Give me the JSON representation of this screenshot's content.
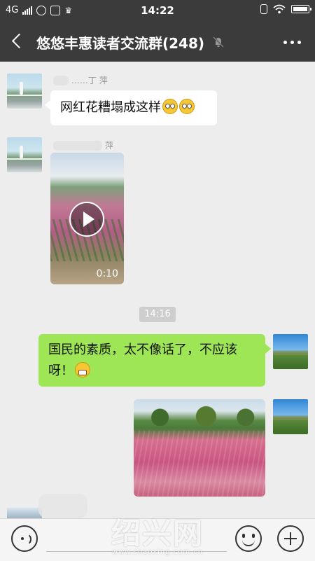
{
  "status_bar": {
    "network": "4G",
    "time": "14:22"
  },
  "header": {
    "title": "悠悠丰惠读者交流群(248)",
    "icons": [
      "back-arrow-icon",
      "mute-icon",
      "more-icon"
    ]
  },
  "messages": [
    {
      "direction": "incoming",
      "sender_name": "……丁 萍",
      "type": "text",
      "text": "网红花糟塌成这样",
      "emoji_count": 2
    },
    {
      "direction": "incoming",
      "sender_name": "萍",
      "type": "video",
      "duration": "0:10"
    },
    {
      "type": "timestamp",
      "text": "14:16"
    },
    {
      "direction": "outgoing",
      "type": "text",
      "text_line1": "国民的素质，太不像话了，不应该",
      "text_line2": "呀！"
    },
    {
      "direction": "outgoing",
      "type": "image"
    }
  ],
  "input_bar": {
    "icons": [
      "voice-icon",
      "emoji-icon",
      "plus-icon"
    ]
  },
  "watermark": {
    "logo_text": "绍兴网",
    "url": "www.shaoxing.com.cn"
  }
}
